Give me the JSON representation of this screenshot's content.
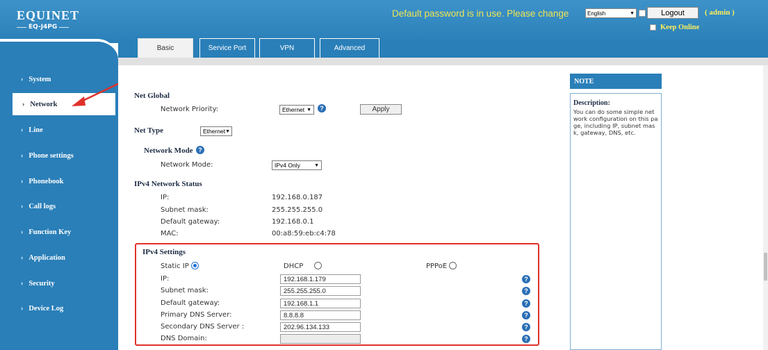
{
  "header": {
    "logo_main": "EQUINET",
    "logo_sub": "EQ-J4PG",
    "warning": "Default password is in use. Please change",
    "language": "English",
    "logout_label": "Logout",
    "user": "( admin )",
    "keep_online": "Keep Online"
  },
  "tabs": [
    {
      "label": "Basic",
      "active": true
    },
    {
      "label": "Service Port",
      "active": false
    },
    {
      "label": "VPN",
      "active": false
    },
    {
      "label": "Advanced",
      "active": false
    }
  ],
  "sidebar": {
    "items": [
      {
        "label": "System"
      },
      {
        "label": "Network",
        "active": true
      },
      {
        "label": "Line"
      },
      {
        "label": "Phone settings"
      },
      {
        "label": "Phonebook"
      },
      {
        "label": "Call logs"
      },
      {
        "label": "Function Key"
      },
      {
        "label": "Application"
      },
      {
        "label": "Security"
      },
      {
        "label": "Device Log"
      }
    ]
  },
  "net_global": {
    "title": "Net Global",
    "priority_label": "Network Priority:",
    "priority_value": "Ethernet",
    "apply_label": "Apply"
  },
  "net_type": {
    "title": "Net Type",
    "value": "Ethernet"
  },
  "network_mode": {
    "title": "Network Mode",
    "label": "Network Mode:",
    "value": "IPv4 Only"
  },
  "ipv4_status": {
    "title": "IPv4 Network Status",
    "ip_label": "IP:",
    "ip_value": "192.168.0.187",
    "mask_label": "Subnet mask:",
    "mask_value": "255.255.255.0",
    "gateway_label": "Default gateway:",
    "gateway_value": "192.168.0.1",
    "mac_label": "MAC:",
    "mac_value": "00:a8:59:eb:c4:78"
  },
  "ipv4_settings": {
    "title": "IPv4 Settings",
    "static_label": "Static IP",
    "dhcp_label": "DHCP",
    "pppoe_label": "PPPoE",
    "ip_label": "IP:",
    "ip_value": "192.168.1.179",
    "mask_label": "Subnet mask:",
    "mask_value": "255.255.255.0",
    "gateway_label": "Default gateway:",
    "gateway_value": "192.168.1.1",
    "dns1_label": "Primary DNS Server:",
    "dns1_value": "8.8.8.8",
    "dns2_label": "Secondary DNS Server :",
    "dns2_value": "202.96.134.133",
    "domain_label": "DNS Domain:",
    "domain_value": ""
  },
  "note": {
    "header": "NOTE",
    "title": "Description:",
    "text": "You can do some simple network configuration on this page, including IP, subnet mask, gateway, DNS, etc."
  },
  "colors": {
    "brand_blue": "#2a7fb8",
    "warning_yellow": "#f2e552",
    "highlight_red": "#e0302a"
  }
}
